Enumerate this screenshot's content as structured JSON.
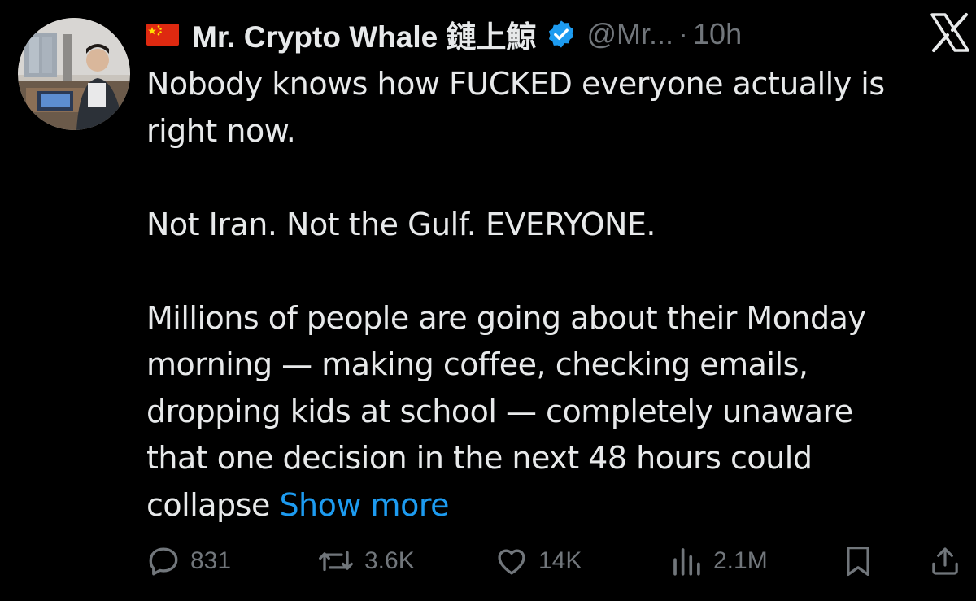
{
  "author": {
    "flag_icon": "china-flag-icon",
    "name": "Mr. Crypto Whale 鏈上鯨",
    "verified_icon": "verified-badge-icon",
    "handle": "@Mr...",
    "separator": "·",
    "time": "10h"
  },
  "platform_icon": "x-logo-icon",
  "tweet": {
    "lines": [
      "Nobody knows how FUCKED everyone actually is",
      "right now.",
      "",
      "Not Iran. Not the Gulf. EVERYONE.",
      "",
      "Millions of people are going about their Monday",
      "morning — making coffee, checking emails,",
      "dropping kids at school — completely unaware",
      "that one decision in the next 48 hours could"
    ],
    "last_line": "collapse",
    "show_more": "Show more"
  },
  "actions": {
    "reply": {
      "icon": "reply-icon",
      "count": "831"
    },
    "repost": {
      "icon": "repost-icon",
      "count": "3.6K"
    },
    "like": {
      "icon": "heart-icon",
      "count": "14K"
    },
    "views": {
      "icon": "views-icon",
      "count": "2.1M"
    },
    "bookmark": {
      "icon": "bookmark-icon"
    },
    "share": {
      "icon": "share-icon"
    }
  },
  "colors": {
    "background": "#000000",
    "text": "#e7e9ea",
    "muted": "#71767b",
    "link": "#1d9bf0"
  }
}
